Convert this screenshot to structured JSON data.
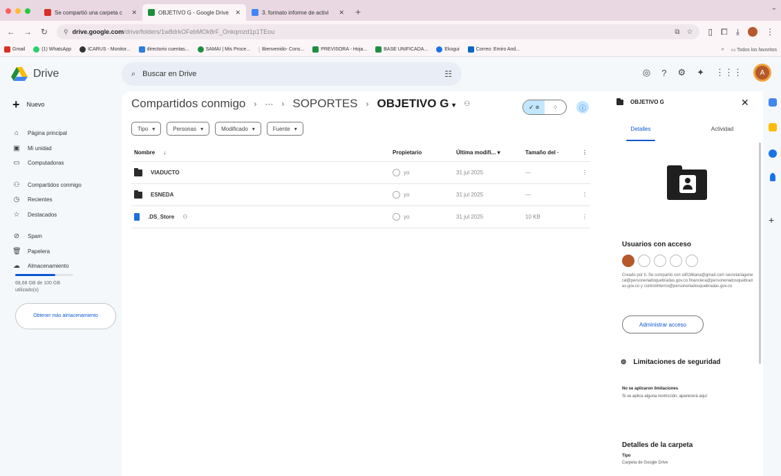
{
  "browser": {
    "tabs": [
      {
        "title": "Se compartió una carpeta c",
        "icon": "gmail-icon",
        "color": "#d93025"
      },
      {
        "title": "OBJETIVO G - Google Drive",
        "icon": "drive-icon",
        "color": "#1e8e3e"
      },
      {
        "title": "3. formato informe de activi",
        "icon": "docs-icon",
        "color": "#4285f4"
      }
    ],
    "url_host": "drive.google.com",
    "url_path": "/drive/folders/1w8drkOFebMOk8rF_Onkqmzd1p1TEou",
    "bookmarks": [
      "Gmail",
      "(1) WhatsApp",
      "ICARUS - Monitor...",
      "directorio cuentas...",
      "SAMAI | Mis Proce...",
      "Bienvenido- Cons...",
      "PREVISORA - Hoja...",
      "BASE UNIFICADA...",
      "Ekogui",
      "Correo: Emiro And..."
    ],
    "bookmarks_all": "Todos los favoritos"
  },
  "header": {
    "app_name": "Drive",
    "search_placeholder": "Buscar en Drive"
  },
  "sidebar": {
    "new_label": "Nuevo",
    "items": [
      {
        "label": "Página principal",
        "icon": "home-icon"
      },
      {
        "label": "Mi unidad",
        "icon": "my-drive-icon"
      },
      {
        "label": "Computadoras",
        "icon": "computer-icon"
      },
      {
        "label": "Compartidos conmigo",
        "icon": "people-icon"
      },
      {
        "label": "Recientes",
        "icon": "clock-icon"
      },
      {
        "label": "Destacados",
        "icon": "star-icon"
      },
      {
        "label": "Spam",
        "icon": "spam-icon"
      },
      {
        "label": "Papelera",
        "icon": "trash-icon"
      },
      {
        "label": "Almacenamiento",
        "icon": "cloud-icon"
      }
    ],
    "storage_used_fraction": 0.69,
    "storage_text": "68,68 GB de 100 GB utilizado(s)",
    "get_more": "Obtener más almacenamiento"
  },
  "main": {
    "breadcrumb": {
      "root": "Compartidos conmigo",
      "ellipsis": "···",
      "parent": "SOPORTES",
      "current": "OBJETIVO G"
    },
    "filters": [
      "Tipo",
      "Personas",
      "Modificado",
      "Fuente"
    ],
    "columns": {
      "name": "Nombre",
      "owner": "Propietario",
      "modified": "Última modifi...",
      "size": "Tamaño del ·"
    },
    "rows": [
      {
        "name": "VIADUCTO",
        "owner": "yo",
        "modified": "31 jul 2025",
        "size": "—",
        "kind": "folder"
      },
      {
        "name": "ESNEDA",
        "owner": "yo",
        "modified": "31 jul 2025",
        "size": "—",
        "kind": "folder"
      },
      {
        "name": ".DS_Store",
        "owner": "yo",
        "modified": "31 jul 2025",
        "size": "10 KB",
        "kind": "file"
      }
    ]
  },
  "details": {
    "title": "OBJETIVO G",
    "tab_details": "Detalles",
    "tab_activity": "Actividad",
    "users_heading": "Usuarios con acceso",
    "share_text": "Creado por ti. Se compartió con sil026llana@gmail.com secretariageneral@personeriadoquebradas.gov.co financiera@personeriadosquebradas.gov.co y controlinterno@personeriadosquebradas.gov.co",
    "manage_access": "Administrar acceso",
    "security_heading": "Limitaciones de seguridad",
    "security_bold": "No se aplicaron limitaciones",
    "security_note": "Si se aplica alguna restricción, aparecerá aquí",
    "folder_details": "Detalles de la carpeta",
    "type_label": "Tipo",
    "type_value": "Carpeta de Google Drive"
  }
}
